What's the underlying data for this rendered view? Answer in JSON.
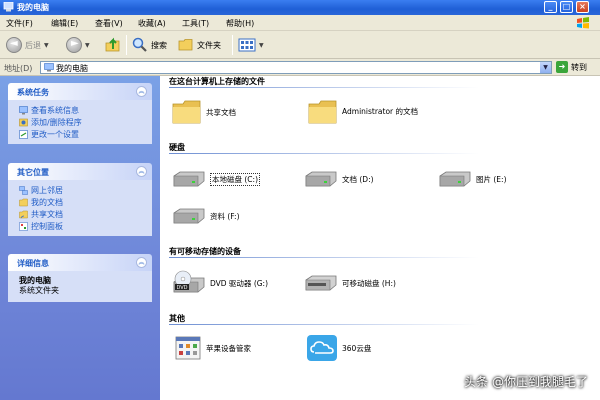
{
  "window": {
    "title": "我的电脑"
  },
  "menu": [
    "文件(F)",
    "编辑(E)",
    "查看(V)",
    "收藏(A)",
    "工具(T)",
    "帮助(H)"
  ],
  "toolbar": {
    "back": "后退",
    "search": "搜索",
    "folders": "文件夹"
  },
  "address": {
    "label": "地址(D)",
    "value": "我的电脑",
    "go": "转到"
  },
  "left": {
    "system_tasks": {
      "title": "系统任务",
      "items": [
        "查看系统信息",
        "添加/删除程序",
        "更改一个设置"
      ]
    },
    "other_places": {
      "title": "其它位置",
      "items": [
        "网上邻居",
        "我的文档",
        "共享文档",
        "控制面板"
      ]
    },
    "details": {
      "title": "详细信息",
      "name": "我的电脑",
      "type": "系统文件夹"
    }
  },
  "sections": {
    "stored_files": {
      "title": "在这台计算机上存储的文件",
      "items": [
        "共享文档",
        "Administrator 的文档"
      ]
    },
    "hard_drives": {
      "title": "硬盘",
      "items": [
        "本地磁盘 (C:)",
        "文档 (D:)",
        "图片 (E:)",
        "资料 (F:)"
      ]
    },
    "removable": {
      "title": "有可移动存储的设备",
      "items": [
        "DVD 驱动器 (G:)",
        "可移动磁盘 (H:)"
      ]
    },
    "other": {
      "title": "其他",
      "items": [
        "苹果设备管家",
        "360云盘"
      ]
    }
  },
  "watermark": "头条 @你压到我腿毛了",
  "colors": {
    "titlebar": "#2a66d8",
    "leftpane": "#6f86d8",
    "link": "#215dc6"
  }
}
